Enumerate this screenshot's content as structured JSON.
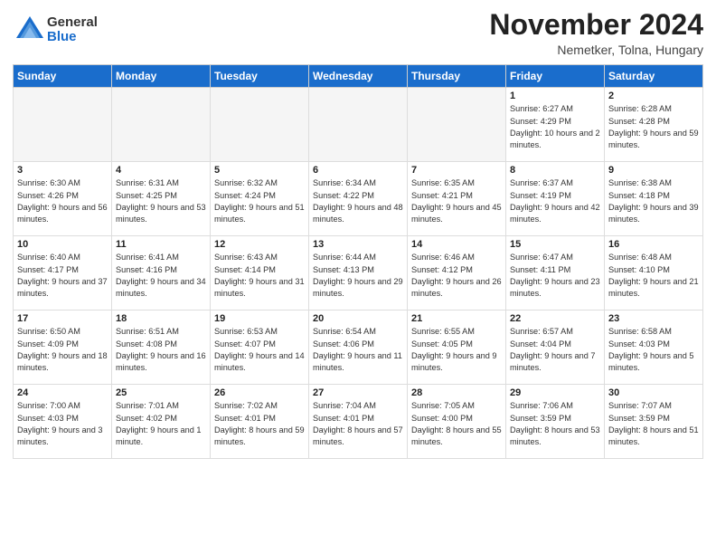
{
  "logo": {
    "general": "General",
    "blue": "Blue"
  },
  "title": "November 2024",
  "location": "Nemetker, Tolna, Hungary",
  "headers": [
    "Sunday",
    "Monday",
    "Tuesday",
    "Wednesday",
    "Thursday",
    "Friday",
    "Saturday"
  ],
  "weeks": [
    [
      {
        "day": "",
        "info": ""
      },
      {
        "day": "",
        "info": ""
      },
      {
        "day": "",
        "info": ""
      },
      {
        "day": "",
        "info": ""
      },
      {
        "day": "",
        "info": ""
      },
      {
        "day": "1",
        "info": "Sunrise: 6:27 AM\nSunset: 4:29 PM\nDaylight: 10 hours\nand 2 minutes."
      },
      {
        "day": "2",
        "info": "Sunrise: 6:28 AM\nSunset: 4:28 PM\nDaylight: 9 hours\nand 59 minutes."
      }
    ],
    [
      {
        "day": "3",
        "info": "Sunrise: 6:30 AM\nSunset: 4:26 PM\nDaylight: 9 hours\nand 56 minutes."
      },
      {
        "day": "4",
        "info": "Sunrise: 6:31 AM\nSunset: 4:25 PM\nDaylight: 9 hours\nand 53 minutes."
      },
      {
        "day": "5",
        "info": "Sunrise: 6:32 AM\nSunset: 4:24 PM\nDaylight: 9 hours\nand 51 minutes."
      },
      {
        "day": "6",
        "info": "Sunrise: 6:34 AM\nSunset: 4:22 PM\nDaylight: 9 hours\nand 48 minutes."
      },
      {
        "day": "7",
        "info": "Sunrise: 6:35 AM\nSunset: 4:21 PM\nDaylight: 9 hours\nand 45 minutes."
      },
      {
        "day": "8",
        "info": "Sunrise: 6:37 AM\nSunset: 4:19 PM\nDaylight: 9 hours\nand 42 minutes."
      },
      {
        "day": "9",
        "info": "Sunrise: 6:38 AM\nSunset: 4:18 PM\nDaylight: 9 hours\nand 39 minutes."
      }
    ],
    [
      {
        "day": "10",
        "info": "Sunrise: 6:40 AM\nSunset: 4:17 PM\nDaylight: 9 hours\nand 37 minutes."
      },
      {
        "day": "11",
        "info": "Sunrise: 6:41 AM\nSunset: 4:16 PM\nDaylight: 9 hours\nand 34 minutes."
      },
      {
        "day": "12",
        "info": "Sunrise: 6:43 AM\nSunset: 4:14 PM\nDaylight: 9 hours\nand 31 minutes."
      },
      {
        "day": "13",
        "info": "Sunrise: 6:44 AM\nSunset: 4:13 PM\nDaylight: 9 hours\nand 29 minutes."
      },
      {
        "day": "14",
        "info": "Sunrise: 6:46 AM\nSunset: 4:12 PM\nDaylight: 9 hours\nand 26 minutes."
      },
      {
        "day": "15",
        "info": "Sunrise: 6:47 AM\nSunset: 4:11 PM\nDaylight: 9 hours\nand 23 minutes."
      },
      {
        "day": "16",
        "info": "Sunrise: 6:48 AM\nSunset: 4:10 PM\nDaylight: 9 hours\nand 21 minutes."
      }
    ],
    [
      {
        "day": "17",
        "info": "Sunrise: 6:50 AM\nSunset: 4:09 PM\nDaylight: 9 hours\nand 18 minutes."
      },
      {
        "day": "18",
        "info": "Sunrise: 6:51 AM\nSunset: 4:08 PM\nDaylight: 9 hours\nand 16 minutes."
      },
      {
        "day": "19",
        "info": "Sunrise: 6:53 AM\nSunset: 4:07 PM\nDaylight: 9 hours\nand 14 minutes."
      },
      {
        "day": "20",
        "info": "Sunrise: 6:54 AM\nSunset: 4:06 PM\nDaylight: 9 hours\nand 11 minutes."
      },
      {
        "day": "21",
        "info": "Sunrise: 6:55 AM\nSunset: 4:05 PM\nDaylight: 9 hours\nand 9 minutes."
      },
      {
        "day": "22",
        "info": "Sunrise: 6:57 AM\nSunset: 4:04 PM\nDaylight: 9 hours\nand 7 minutes."
      },
      {
        "day": "23",
        "info": "Sunrise: 6:58 AM\nSunset: 4:03 PM\nDaylight: 9 hours\nand 5 minutes."
      }
    ],
    [
      {
        "day": "24",
        "info": "Sunrise: 7:00 AM\nSunset: 4:03 PM\nDaylight: 9 hours\nand 3 minutes."
      },
      {
        "day": "25",
        "info": "Sunrise: 7:01 AM\nSunset: 4:02 PM\nDaylight: 9 hours\nand 1 minute."
      },
      {
        "day": "26",
        "info": "Sunrise: 7:02 AM\nSunset: 4:01 PM\nDaylight: 8 hours\nand 59 minutes."
      },
      {
        "day": "27",
        "info": "Sunrise: 7:04 AM\nSunset: 4:01 PM\nDaylight: 8 hours\nand 57 minutes."
      },
      {
        "day": "28",
        "info": "Sunrise: 7:05 AM\nSunset: 4:00 PM\nDaylight: 8 hours\nand 55 minutes."
      },
      {
        "day": "29",
        "info": "Sunrise: 7:06 AM\nSunset: 3:59 PM\nDaylight: 8 hours\nand 53 minutes."
      },
      {
        "day": "30",
        "info": "Sunrise: 7:07 AM\nSunset: 3:59 PM\nDaylight: 8 hours\nand 51 minutes."
      }
    ]
  ]
}
